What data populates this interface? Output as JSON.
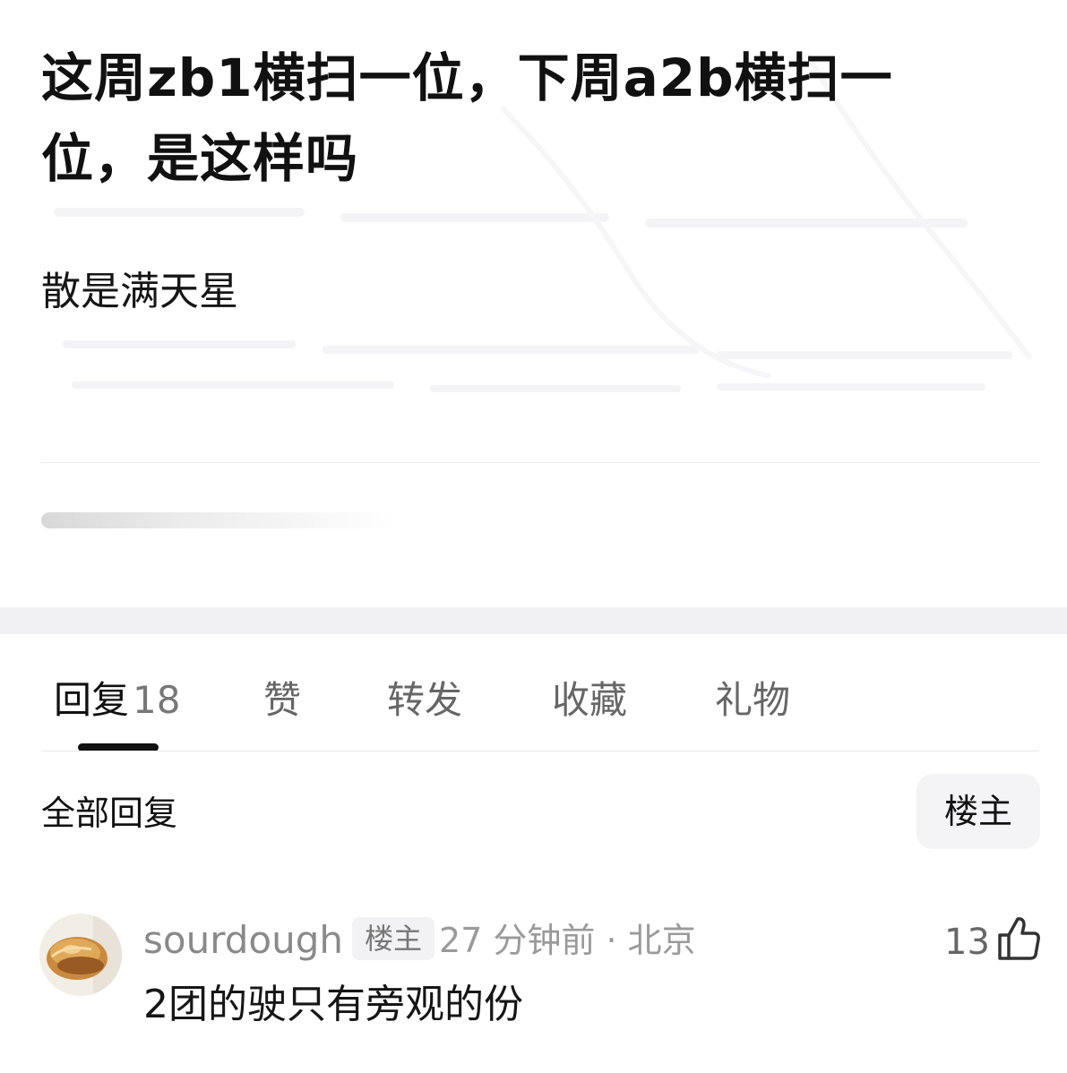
{
  "post": {
    "title": "这周zb1横扫一位，下周a2b横扫一位，是这样吗",
    "body": "散是满天星"
  },
  "tabs": [
    {
      "label": "回复",
      "count": "18"
    },
    {
      "label": "赞"
    },
    {
      "label": "转发"
    },
    {
      "label": "收藏"
    },
    {
      "label": "礼物"
    }
  ],
  "replies": {
    "title": "全部回复",
    "filter_label": "楼主"
  },
  "comments": [
    {
      "username": "sourdough",
      "badge": "楼主",
      "meta": "27 分钟前 · 北京",
      "likes": "13",
      "text": "2团的驶只有旁观的份"
    }
  ],
  "icons": {
    "like": "thumbs-up-icon",
    "avatar": "bread-avatar"
  }
}
